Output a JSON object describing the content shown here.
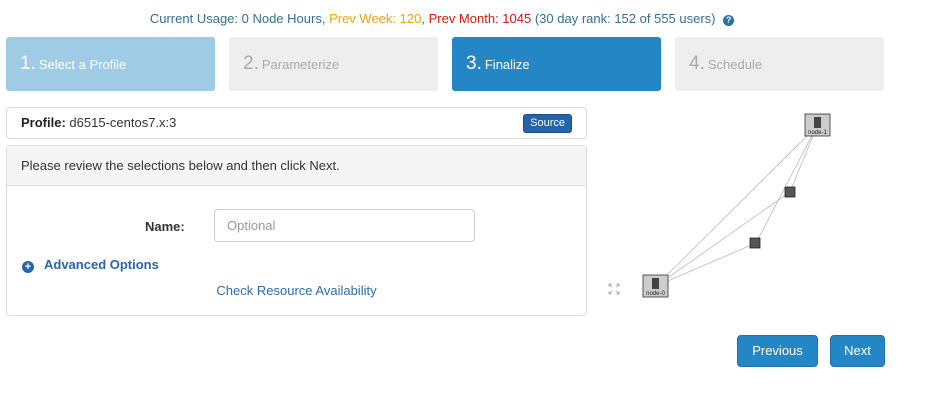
{
  "usage": {
    "current": "Current Usage: 0 Node Hours,",
    "week": "Prev Week: 120",
    "sep": ",",
    "month": "Prev Month: 1045",
    "rank": "(30 day rank: 152 of 555 users)",
    "help_icon": "?"
  },
  "steps": [
    {
      "num": "1.",
      "label": "Select a Profile",
      "state": "done"
    },
    {
      "num": "2.",
      "label": "Parameterize",
      "state": "todo"
    },
    {
      "num": "3.",
      "label": "Finalize",
      "state": "active"
    },
    {
      "num": "4.",
      "label": "Schedule",
      "state": "todo"
    }
  ],
  "profile": {
    "label": "Profile:",
    "value": "d6515-centos7.x:3",
    "source_button": "Source"
  },
  "panel": {
    "heading": "Please review the selections below and then click Next.",
    "name_label": "Name:",
    "name_placeholder": "Optional",
    "name_value": "",
    "advanced": "Advanced Options",
    "check": "Check Resource Availability"
  },
  "topology": {
    "nodes": [
      "node-1",
      "node-0"
    ]
  },
  "buttons": {
    "previous": "Previous",
    "next": "Next"
  },
  "colors": {
    "primary": "#2586c6",
    "done": "#9fcbe5",
    "todo": "#eeeeee",
    "week": "#f0a30a",
    "month": "#d9150c",
    "link": "#2a6fad"
  }
}
